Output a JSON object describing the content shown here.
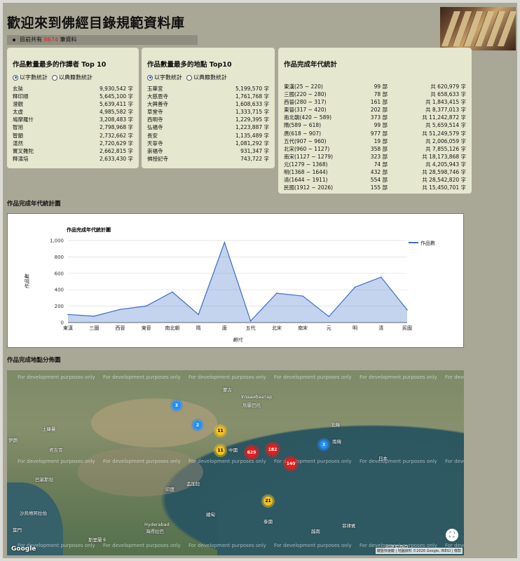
{
  "header": {
    "title": "歡迎來到佛經目錄規範資料庫",
    "count_prefix": "目前共有",
    "count_value": "8674",
    "count_suffix": "筆資料"
  },
  "translators_panel": {
    "title": "作品數量最多的作譯者 Top 10",
    "radio_chars": "以字數統計",
    "radio_books": "以典籍數統計",
    "rows": [
      {
        "name": "玄奘",
        "value": "9,930,542 字"
      },
      {
        "name": "釋印順",
        "value": "5,645,100 字"
      },
      {
        "name": "澄觀",
        "value": "5,639,411 字"
      },
      {
        "name": "太虛",
        "value": "4,985,582 字"
      },
      {
        "name": "鳩摩羅什",
        "value": "3,208,483 字"
      },
      {
        "name": "智旭",
        "value": "2,798,968 字"
      },
      {
        "name": "智顗",
        "value": "2,732,662 字"
      },
      {
        "name": "湛然",
        "value": "2,720,629 字"
      },
      {
        "name": "實叉難陀",
        "value": "2,662,815 字"
      },
      {
        "name": "釋演培",
        "value": "2,633,430 字"
      }
    ]
  },
  "places_panel": {
    "title": "作品數量最多的地點 Top10",
    "radio_chars": "以字數統計",
    "radio_books": "以典籍數統計",
    "rows": [
      {
        "name": "玉華宮",
        "value": "5,199,570 字"
      },
      {
        "name": "大慈恩寺",
        "value": "1,761,768 字"
      },
      {
        "name": "大興善寺",
        "value": "1,608,633 字"
      },
      {
        "name": "草堂寺",
        "value": "1,333,715 字"
      },
      {
        "name": "西明寺",
        "value": "1,229,395 字"
      },
      {
        "name": "弘福寺",
        "value": "1,223,887 字"
      },
      {
        "name": "長安",
        "value": "1,135,489 字"
      },
      {
        "name": "天寧寺",
        "value": "1,081,292 字"
      },
      {
        "name": "崇福寺",
        "value": "931,347 字"
      },
      {
        "name": "佛授記寺",
        "value": "743,722 字"
      }
    ]
  },
  "era_panel": {
    "title": "作品完成年代統計",
    "rows": [
      {
        "era": "東漢(25 ~ 220)",
        "count": "99 部",
        "chars": "共 620,979 字"
      },
      {
        "era": "三國(220 ~ 280)",
        "count": "78 部",
        "chars": "共 658,633 字"
      },
      {
        "era": "西晉(280 ~ 317)",
        "count": "161 部",
        "chars": "共 1,843,415 字"
      },
      {
        "era": "東晉(317 ~ 420)",
        "count": "202 部",
        "chars": "共 8,377,013 字"
      },
      {
        "era": "南北朝(420 ~ 589)",
        "count": "373 部",
        "chars": "共 11,242,872 字"
      },
      {
        "era": "隋(589 ~ 618)",
        "count": "99 部",
        "chars": "共 5,659,514 字"
      },
      {
        "era": "唐(618 ~ 907)",
        "count": "977 部",
        "chars": "共 51,249,579 字"
      },
      {
        "era": "五代(907 ~ 960)",
        "count": "19 部",
        "chars": "共 2,006,059 字"
      },
      {
        "era": "北宋(960 ~ 1127)",
        "count": "358 部",
        "chars": "共 7,855,126 字"
      },
      {
        "era": "南宋(1127 ~ 1279)",
        "count": "323 部",
        "chars": "共 18,173,868 字"
      },
      {
        "era": "元(1279 ~ 1368)",
        "count": "74 部",
        "chars": "共 4,205,943 字"
      },
      {
        "era": "明(1368 ~ 1644)",
        "count": "432 部",
        "chars": "共 28,598,746 字"
      },
      {
        "era": "清(1644 ~ 1911)",
        "count": "554 部",
        "chars": "共 28,542,820 字"
      },
      {
        "era": "民國(1912 ~ 2026)",
        "count": "155 部",
        "chars": "共 15,450,701 字"
      }
    ]
  },
  "chart_section": {
    "title": "作品完成年代統計圖"
  },
  "chart_data": {
    "type": "area",
    "title": "作品完成年代統計圖",
    "xlabel": "朝代",
    "ylabel": "作品數",
    "categories": [
      "東漢",
      "三國",
      "西晉",
      "東晉",
      "南北朝",
      "隋",
      "唐",
      "五代",
      "北宋",
      "南宋",
      "元",
      "明",
      "清",
      "民國"
    ],
    "series": [
      {
        "name": "作品數",
        "values": [
          99,
          78,
          161,
          202,
          373,
          99,
          977,
          19,
          358,
          323,
          74,
          432,
          554,
          155
        ],
        "color": "#3b6cc8"
      }
    ],
    "ylim": [
      0,
      1000
    ],
    "yticks": [
      "0",
      "200",
      "400",
      "600",
      "800",
      "1,000"
    ],
    "grid": true,
    "legend": "right"
  },
  "map_section": {
    "title": "作品完成地點分佈圖",
    "watermark": "For development purposes only",
    "labels": [
      "蒙古",
      "Улаанбаатар",
      "烏蘭巴托",
      "土庫曼",
      "塔吉克",
      "中國",
      "印度",
      "孟加拉",
      "Hyderabad",
      "海得拉巴",
      "斯里蘭卡",
      "泰國",
      "越南",
      "菲律賓",
      "日本",
      "南韓",
      "北韓",
      "巴基斯坦",
      "伊朗",
      "葉門",
      "沙烏地阿拉伯",
      "緬甸",
      "印度尼西亞"
    ],
    "clusters": [
      {
        "label": "3",
        "color": "blue"
      },
      {
        "label": "2",
        "color": "blue"
      },
      {
        "label": "11",
        "color": "yellow"
      },
      {
        "label": "11",
        "color": "yellow"
      },
      {
        "label": "629",
        "color": "red"
      },
      {
        "label": "182",
        "color": "red"
      },
      {
        "label": "140",
        "color": "red"
      },
      {
        "label": "3",
        "color": "blue"
      },
      {
        "label": "21",
        "color": "yellow"
      }
    ],
    "google": "Google",
    "footer": "鍵盤快速鍵 | 地圖資料 ©2026 Google, INEGI | 條款"
  }
}
